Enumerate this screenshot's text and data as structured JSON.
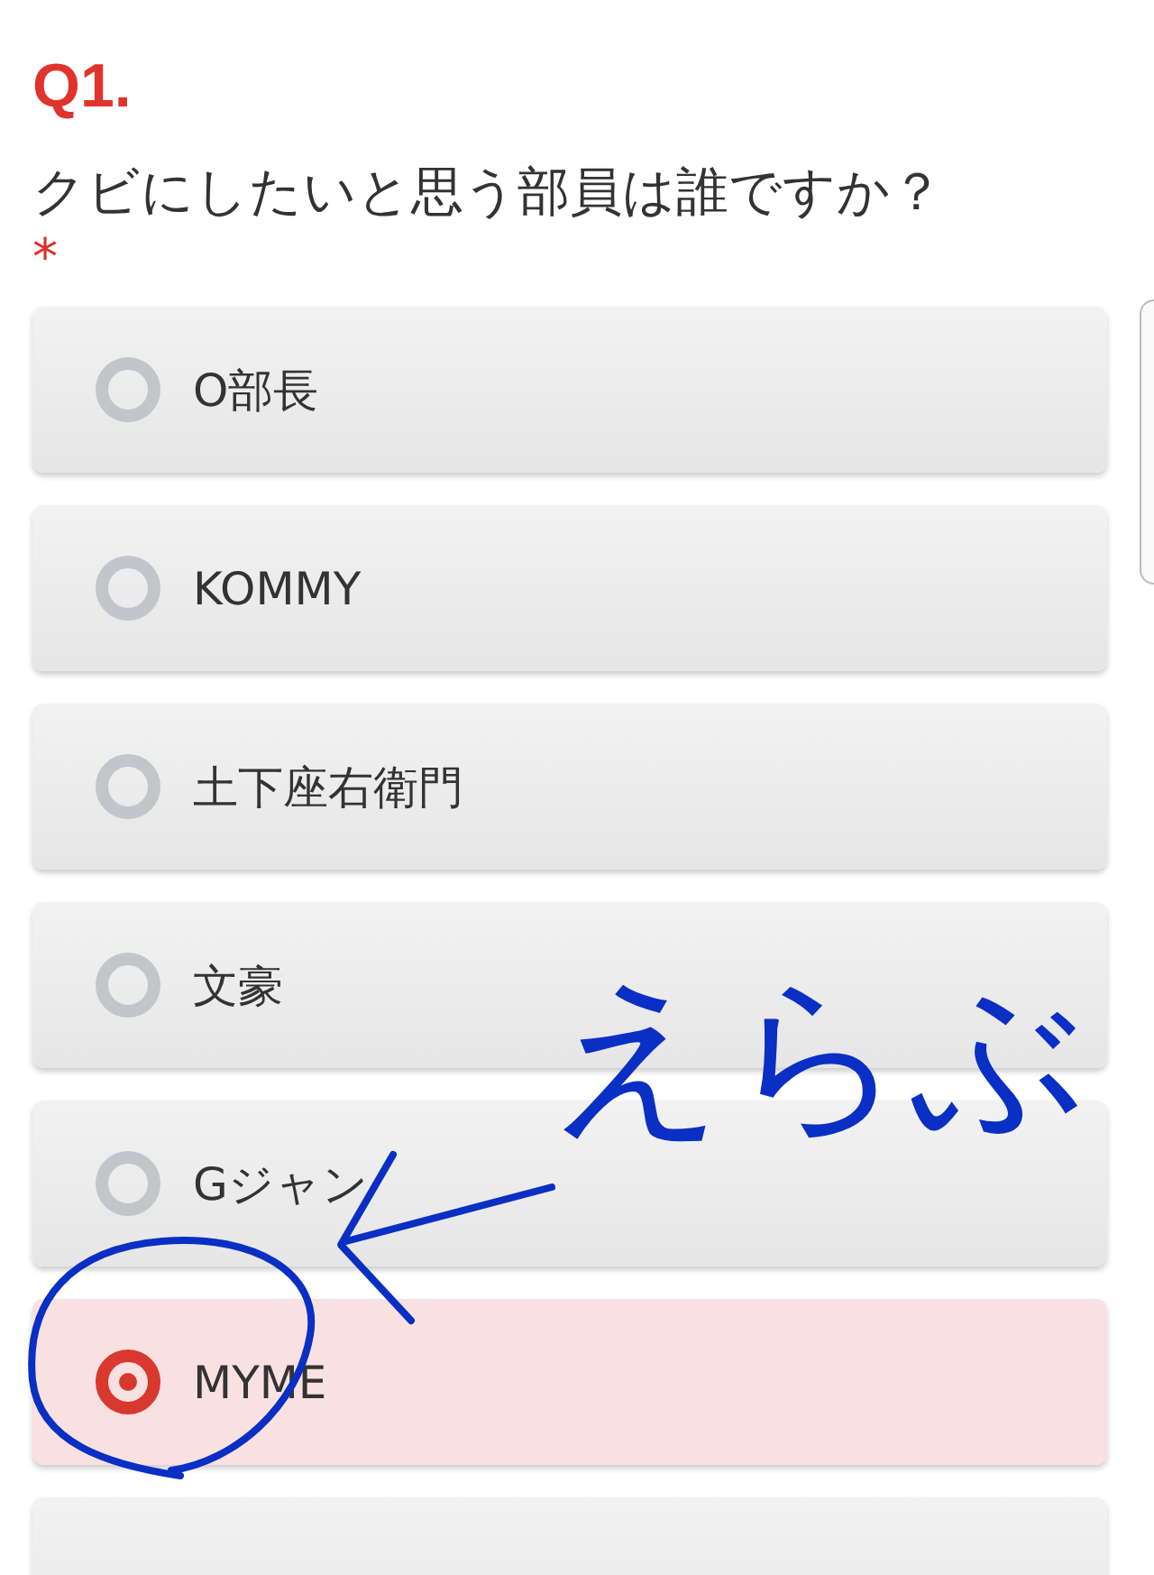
{
  "question": {
    "number": "Q1.",
    "text": "クビにしたいと思う部員は誰ですか？",
    "required_mark": "*"
  },
  "options": [
    {
      "label": "O部長",
      "selected": false
    },
    {
      "label": "KOMMY",
      "selected": false
    },
    {
      "label": "土下座右衛門",
      "selected": false
    },
    {
      "label": "文豪",
      "selected": false
    },
    {
      "label": "Gジャン",
      "selected": false
    },
    {
      "label": "MYME",
      "selected": true
    }
  ],
  "more_options_below": true,
  "annotations": [
    {
      "kind": "text",
      "text": "えらぶ"
    },
    {
      "kind": "arrow"
    },
    {
      "kind": "circle"
    }
  ]
}
